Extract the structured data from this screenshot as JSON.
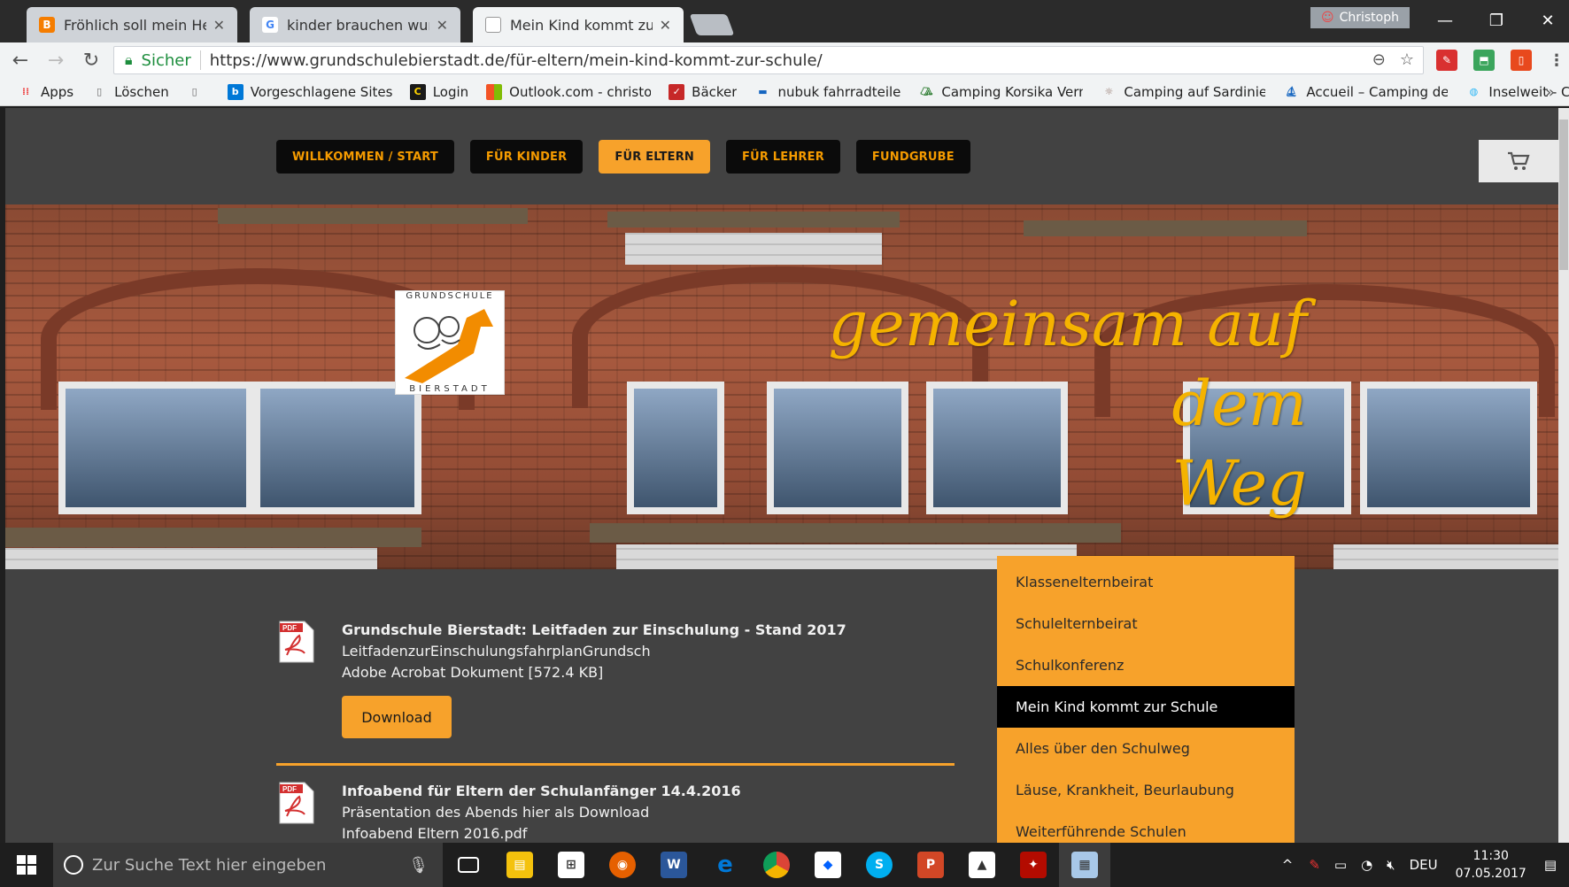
{
  "browser": {
    "tabs": [
      {
        "title": "Fröhlich soll mein Herze",
        "favicon": "blogger-icon",
        "color": "#f57d00"
      },
      {
        "title": "kinder brauchen wurzel",
        "favicon": "google-icon",
        "color": "#4285f4"
      },
      {
        "title": "Mein Kind kommt zur Sc",
        "favicon": "page-icon",
        "color": "#888888"
      }
    ],
    "profile_name": "Christoph",
    "secure_label": "Sicher",
    "url": "https://www.grundschulebierstadt.de/für-eltern/mein-kind-kommt-zur-schule/",
    "bookmarks": [
      {
        "label": "Apps",
        "icon": "apps-icon"
      },
      {
        "label": "Löschen",
        "icon": "page-icon"
      },
      {
        "label": "",
        "icon": "page-icon"
      },
      {
        "label": "Vorgeschlagene Sites",
        "icon": "bing-icon"
      },
      {
        "label": "Login",
        "icon": "c-icon"
      },
      {
        "label": "Outlook.com - christo",
        "icon": "windows-icon"
      },
      {
        "label": "Bäcker",
        "icon": "bakery-icon"
      },
      {
        "label": "nubuk fahrradteile",
        "icon": "bike-icon"
      },
      {
        "label": "Camping Korsika Vern",
        "icon": "tent-icon"
      },
      {
        "label": "Camping auf Sardinie",
        "icon": "sun-icon"
      },
      {
        "label": "Accueil – Camping de",
        "icon": "boat-icon"
      },
      {
        "label": "Inselweit - Campingca",
        "icon": "globe-icon"
      }
    ]
  },
  "site": {
    "nav": [
      {
        "label": "WILLKOMMEN / START",
        "active": false
      },
      {
        "label": "FÜR KINDER",
        "active": false
      },
      {
        "label": "FÜR ELTERN",
        "active": true
      },
      {
        "label": "FÜR LEHRER",
        "active": false
      },
      {
        "label": "FUNDGRUBE",
        "active": false
      }
    ],
    "logo_top": "GRUNDSCHULE",
    "logo_bottom": "BIERSTADT",
    "slogan_line1": "gemeinsam auf dem",
    "slogan_line2": "Weg",
    "side_menu": [
      {
        "label": "Klassenelternbeirat",
        "active": false
      },
      {
        "label": "Schulelternbeirat",
        "active": false
      },
      {
        "label": "Schulkonferenz",
        "active": false
      },
      {
        "label": "Mein Kind kommt zur Schule",
        "active": true
      },
      {
        "label": "Alles über den Schulweg",
        "active": false
      },
      {
        "label": "Läuse, Krankheit, Beurlaubung",
        "active": false
      },
      {
        "label": "Weiterführende Schulen",
        "active": false
      }
    ],
    "documents": [
      {
        "title": "Grundschule Bierstadt: Leitfaden zur Einschulung - Stand 2017",
        "line2": "LeitfadenzurEinschulungsfahrplanGrundsch",
        "line3": "Adobe Acrobat Dokument [572.4 KB]",
        "button": "Download"
      },
      {
        "title": "Infoabend für Eltern der Schulanfänger 14.4.2016",
        "line2": "Präsentation des Abends hier als Download",
        "line3": "Infoabend Eltern 2016.pdf"
      }
    ],
    "accent_color": "#f7a22b"
  },
  "taskbar": {
    "search_placeholder": "Zur Suche Text hier eingeben",
    "language": "DEU",
    "time": "11:30",
    "date": "07.05.2017"
  }
}
